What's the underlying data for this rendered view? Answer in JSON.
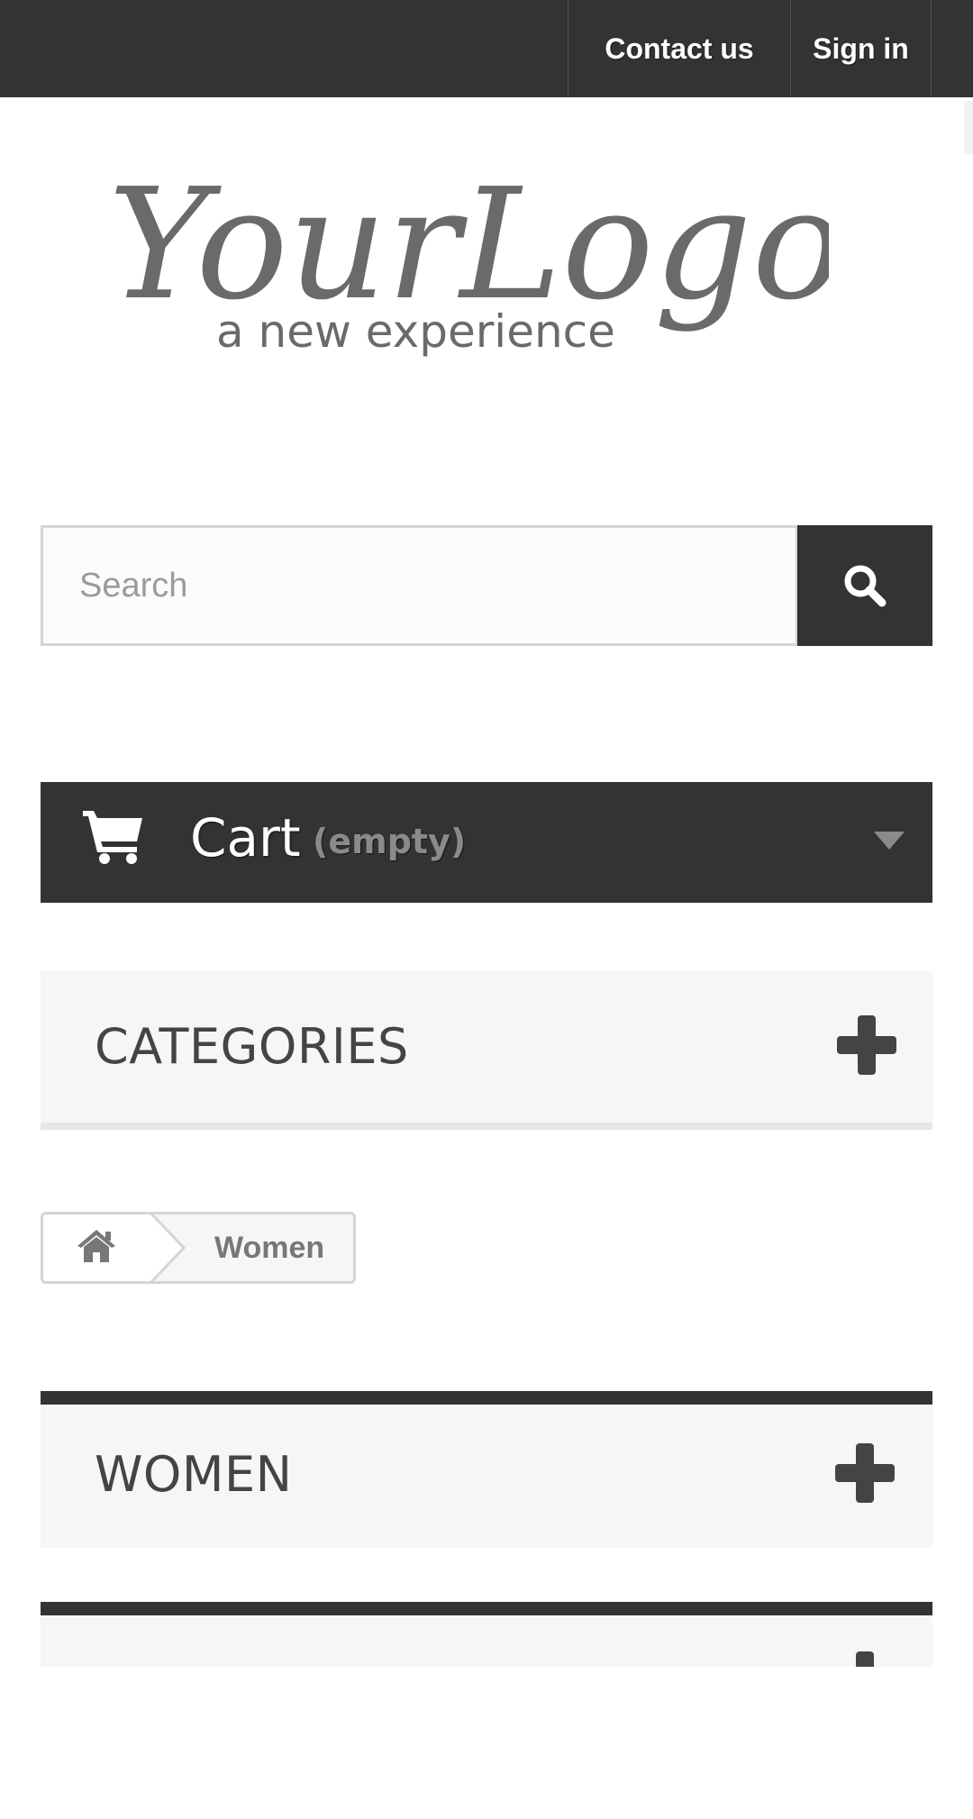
{
  "header": {
    "nav": {
      "contact_label": "Contact us",
      "signin_label": "Sign in"
    },
    "logo": {
      "main_text": "YourLogo",
      "tagline": "a new experience"
    }
  },
  "search": {
    "placeholder": "Search",
    "button_icon": "search-icon"
  },
  "cart": {
    "label": "Cart",
    "status": "(empty)",
    "icon": "cart-icon",
    "toggle_icon": "caret-down-icon"
  },
  "categories_block": {
    "title": "CATEGORIES",
    "toggle_icon": "plus-icon"
  },
  "breadcrumb": {
    "home_icon": "home-icon",
    "current": "Women"
  },
  "sections": {
    "women_title": "WOMEN",
    "toggle_icon": "plus-icon"
  },
  "colors": {
    "dark": "#333333",
    "block_bg": "#f6f6f6",
    "text": "#444444"
  }
}
